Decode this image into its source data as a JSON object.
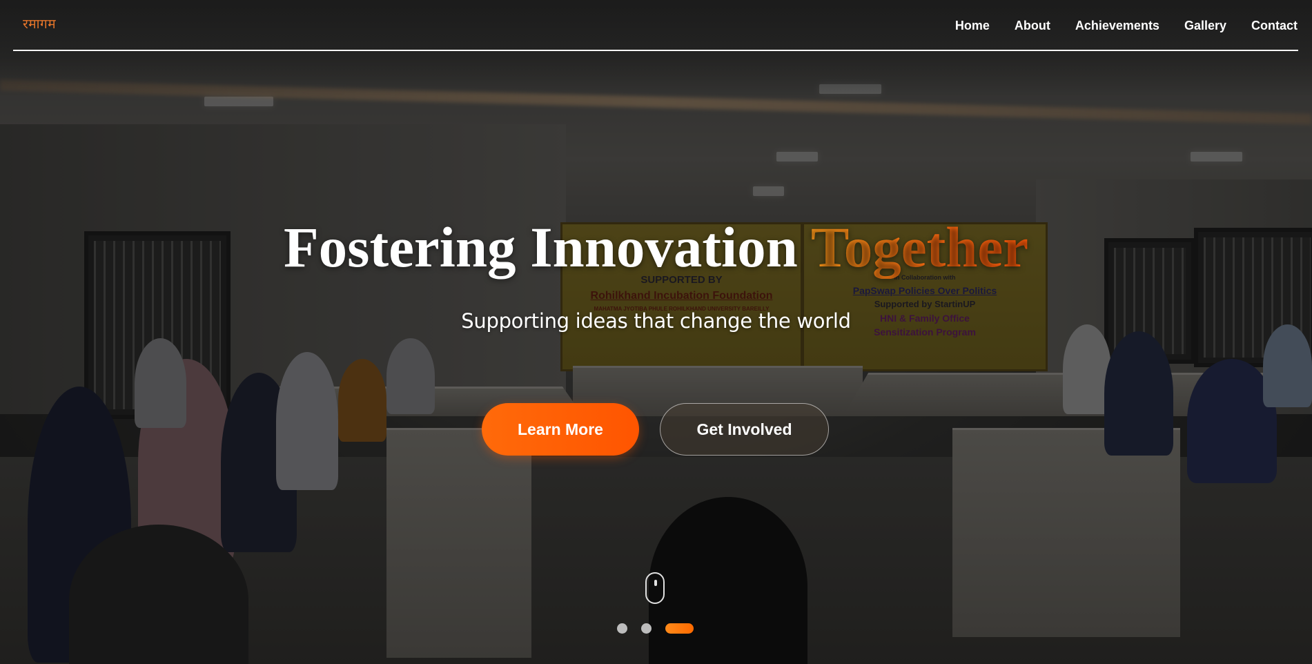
{
  "brand": {
    "logo_text": "रमागम",
    "accent_color": "#ff6a00"
  },
  "nav": {
    "items": [
      {
        "label": "Home"
      },
      {
        "label": "About"
      },
      {
        "label": "Achievements"
      },
      {
        "label": "Gallery"
      },
      {
        "label": "Contact"
      }
    ]
  },
  "hero": {
    "title_main": "Fostering Innovation ",
    "title_accent": "Together",
    "subtitle": "Supporting ideas that change the world",
    "buttons": {
      "primary_label": "Learn More",
      "secondary_label": "Get Involved"
    },
    "scroll_indicator_icon": "mouse-scroll-icon",
    "slider": {
      "total": 3,
      "active_index": 2
    },
    "background_banner": {
      "left_lines": [
        "SUPPORTED BY",
        "Rohilkhand Incubation Foundation",
        "MAHATMA JYOTIBA PHULE ROHILKHAND UNIVERSITY BAREILLY"
      ],
      "right_lines": [
        "In Collaboration with",
        "PapSwap Policies Over Politics",
        "Supported by StartinUP",
        "HNI & Family Office",
        "Sensitization Program"
      ]
    }
  }
}
